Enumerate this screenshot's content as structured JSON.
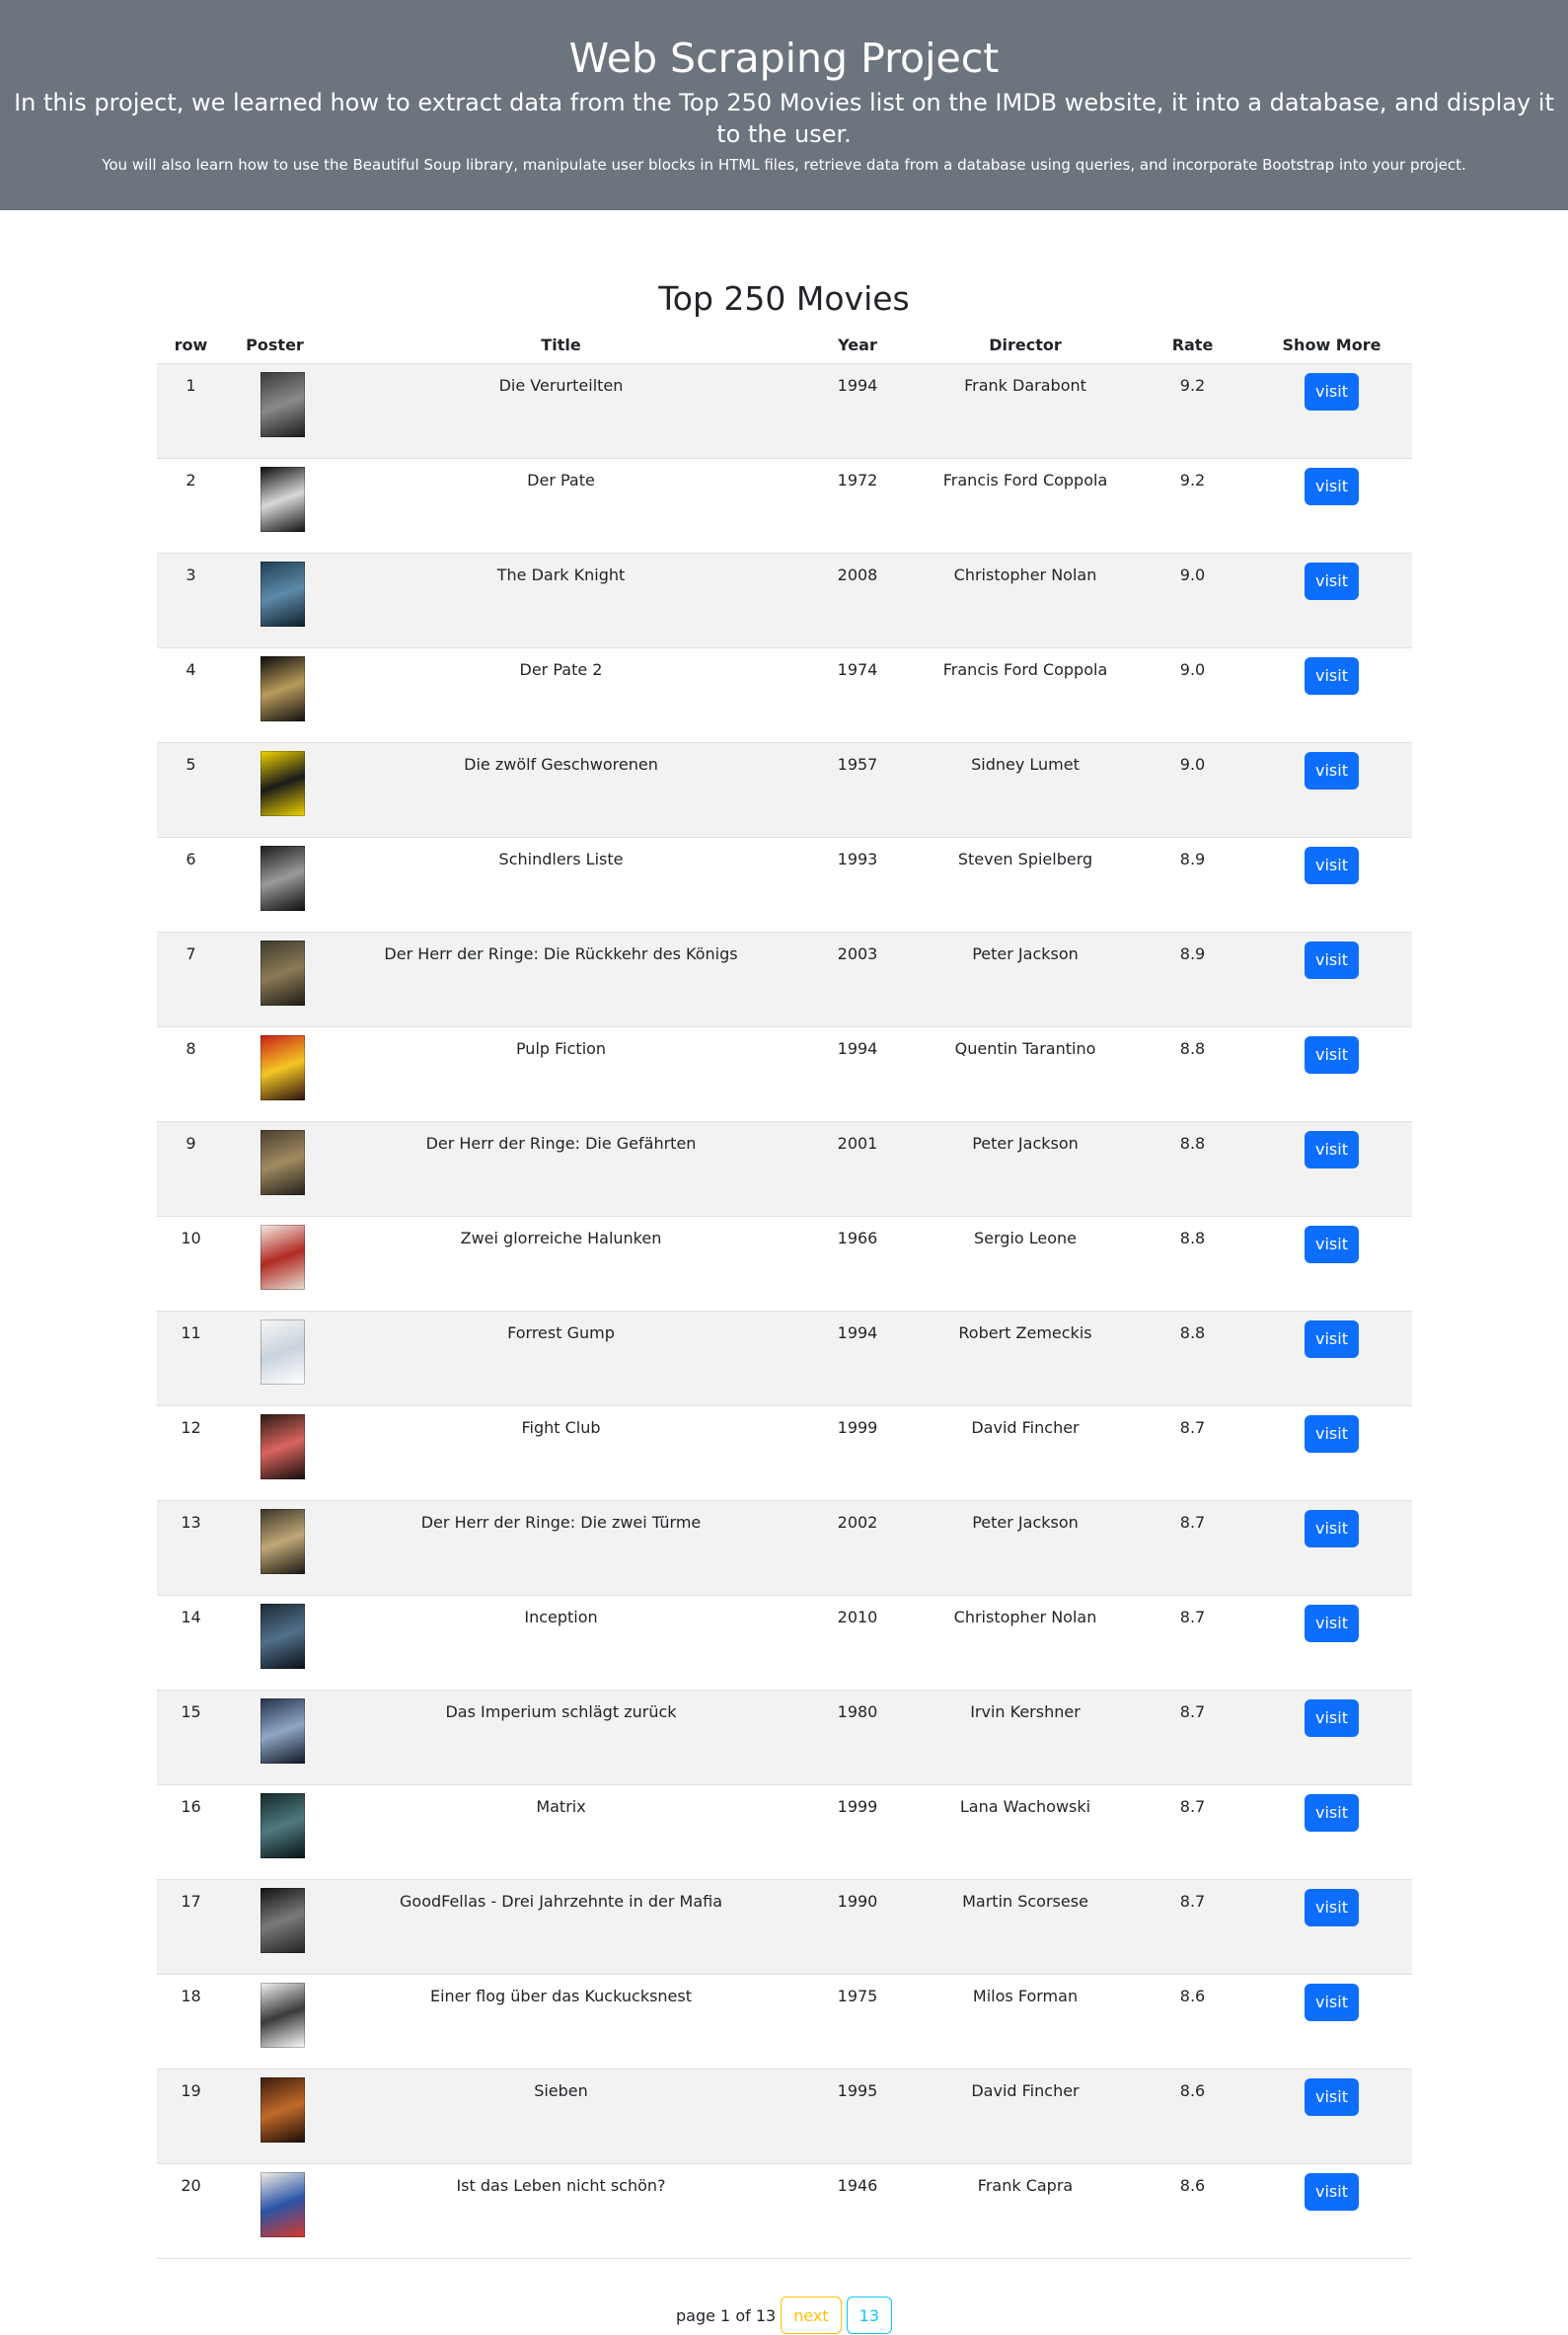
{
  "header": {
    "title": "Web Scraping Project",
    "lead": "In this project, we learned how to extract data from the Top 250 Movies list on the IMDB website, it into a database, and display it to the user.",
    "sub": "You will also learn how to use the Beautiful Soup library, manipulate user blocks in HTML files, retrieve data from a database using queries, and incorporate Bootstrap into your project."
  },
  "colors": {
    "header_bg": "#6c757d",
    "primary": "#0d6efd",
    "warning": "#ffc107",
    "info": "#0dcaf0",
    "stripe": "#f2f2f2"
  },
  "table": {
    "title": "Top 250 Movies",
    "columns": [
      "row",
      "Poster",
      "Title",
      "Year",
      "Director",
      "Rate",
      "Show More"
    ],
    "button_label": "visit",
    "rows": [
      {
        "row": "1",
        "title": "Die Verurteilten",
        "year": "1994",
        "director": "Frank Darabont",
        "rate": "9.2",
        "poster_colors": [
          "#3a3a3a",
          "#8a8a8a",
          "#1a1a1a"
        ]
      },
      {
        "row": "2",
        "title": "Der Pate",
        "year": "1972",
        "director": "Francis Ford Coppola",
        "rate": "9.2",
        "poster_colors": [
          "#0a0a0a",
          "#d8d8d8",
          "#111111"
        ]
      },
      {
        "row": "3",
        "title": "The Dark Knight",
        "year": "2008",
        "director": "Christopher Nolan",
        "rate": "9.0",
        "poster_colors": [
          "#1f3f55",
          "#5d8aa8",
          "#0e1e2a"
        ]
      },
      {
        "row": "4",
        "title": "Der Pate 2",
        "year": "1974",
        "director": "Francis Ford Coppola",
        "rate": "9.0",
        "poster_colors": [
          "#0a0a0a",
          "#b89a5a",
          "#111111"
        ]
      },
      {
        "row": "5",
        "title": "Die zwölf Geschworenen",
        "year": "1957",
        "director": "Sidney Lumet",
        "rate": "9.0",
        "poster_colors": [
          "#f2d600",
          "#1a1a1a",
          "#f2d600"
        ]
      },
      {
        "row": "6",
        "title": "Schindlers Liste",
        "year": "1993",
        "director": "Steven Spielberg",
        "rate": "8.9",
        "poster_colors": [
          "#1a1a1a",
          "#9a9a9a",
          "#0c0c0c"
        ]
      },
      {
        "row": "7",
        "title": "Der Herr der Ringe: Die Rückkehr des Königs",
        "year": "2003",
        "director": "Peter Jackson",
        "rate": "8.9",
        "poster_colors": [
          "#3d3a2e",
          "#8c7a55",
          "#1e1c16"
        ]
      },
      {
        "row": "8",
        "title": "Pulp Fiction",
        "year": "1994",
        "director": "Quentin Tarantino",
        "rate": "8.8",
        "poster_colors": [
          "#c8201a",
          "#f3c623",
          "#2a1010"
        ]
      },
      {
        "row": "9",
        "title": "Der Herr der Ringe: Die Gefährten",
        "year": "2001",
        "director": "Peter Jackson",
        "rate": "8.8",
        "poster_colors": [
          "#4a4030",
          "#a08a60",
          "#22201a"
        ]
      },
      {
        "row": "10",
        "title": "Zwei glorreiche Halunken",
        "year": "1966",
        "director": "Sergio Leone",
        "rate": "8.8",
        "poster_colors": [
          "#f4eee6",
          "#b02a22",
          "#e8e0d4"
        ]
      },
      {
        "row": "11",
        "title": "Forrest Gump",
        "year": "1994",
        "director": "Robert Zemeckis",
        "rate": "8.8",
        "poster_colors": [
          "#f7f7f7",
          "#c9d3dc",
          "#ffffff"
        ]
      },
      {
        "row": "12",
        "title": "Fight Club",
        "year": "1999",
        "director": "David Fincher",
        "rate": "8.7",
        "poster_colors": [
          "#2a1a14",
          "#d9645e",
          "#140d0a"
        ]
      },
      {
        "row": "13",
        "title": "Der Herr der Ringe: Die zwei Türme",
        "year": "2002",
        "director": "Peter Jackson",
        "rate": "8.7",
        "poster_colors": [
          "#3a3428",
          "#c0a878",
          "#1a1812"
        ]
      },
      {
        "row": "14",
        "title": "Inception",
        "year": "2010",
        "director": "Christopher Nolan",
        "rate": "8.7",
        "poster_colors": [
          "#1c2a36",
          "#51708a",
          "#0a1016"
        ]
      },
      {
        "row": "15",
        "title": "Das Imperium schlägt zurück",
        "year": "1980",
        "director": "Irvin Kershner",
        "rate": "8.7",
        "poster_colors": [
          "#22324a",
          "#8fa6c4",
          "#101824"
        ]
      },
      {
        "row": "16",
        "title": "Matrix",
        "year": "1999",
        "director": "Lana Wachowski",
        "rate": "8.7",
        "poster_colors": [
          "#15282a",
          "#4e7a80",
          "#081214"
        ]
      },
      {
        "row": "17",
        "title": "GoodFellas - Drei Jahrzehnte in der Mafia",
        "year": "1990",
        "director": "Martin Scorsese",
        "rate": "8.7",
        "poster_colors": [
          "#121212",
          "#7a7a7a",
          "#222222"
        ]
      },
      {
        "row": "18",
        "title": "Einer flog über das Kuckucksnest",
        "year": "1975",
        "director": "Milos Forman",
        "rate": "8.6",
        "poster_colors": [
          "#f4f4f4",
          "#3a3a3a",
          "#ffffff"
        ]
      },
      {
        "row": "19",
        "title": "Sieben",
        "year": "1995",
        "director": "David Fincher",
        "rate": "8.6",
        "poster_colors": [
          "#3a1a0c",
          "#c06a2a",
          "#1c0c06"
        ]
      },
      {
        "row": "20",
        "title": "Ist das Leben nicht schön?",
        "year": "1946",
        "director": "Frank Capra",
        "rate": "8.6",
        "poster_colors": [
          "#f4f0e4",
          "#2a54a8",
          "#d8382a"
        ]
      }
    ]
  },
  "pagination": {
    "status": "page 1 of 13",
    "next_label": "next",
    "last_label": "13"
  }
}
